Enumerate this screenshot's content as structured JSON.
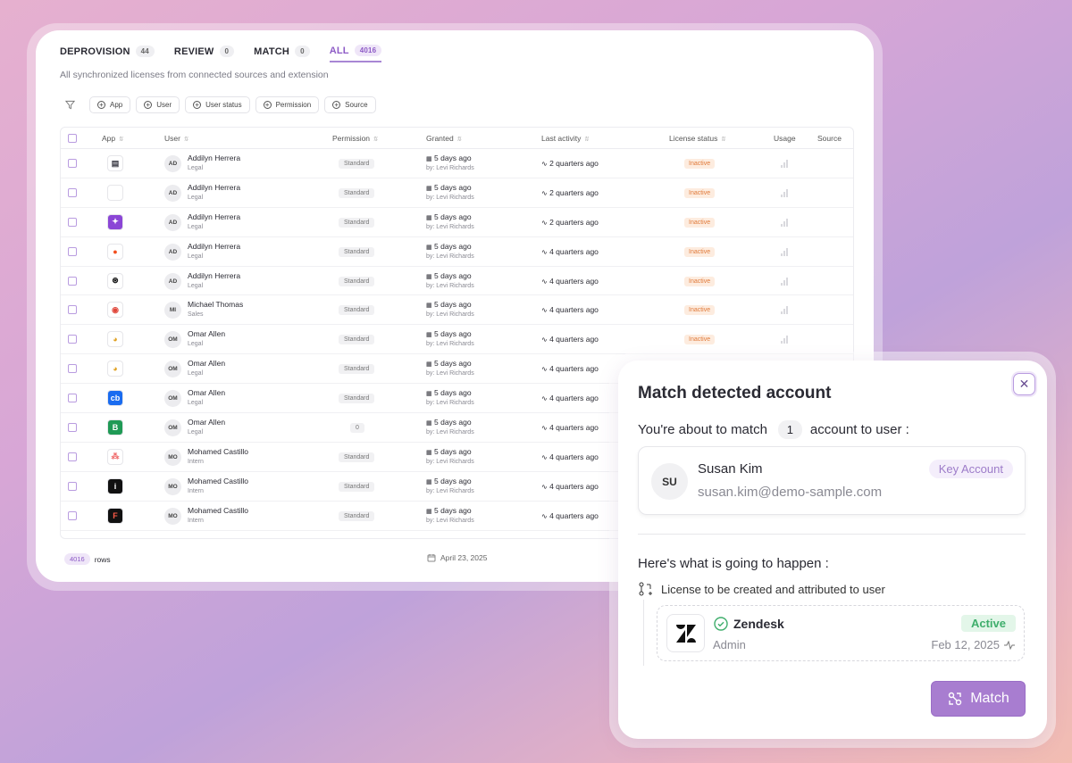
{
  "tabs": [
    {
      "label": "DEPROVISION",
      "count": "44"
    },
    {
      "label": "REVIEW",
      "count": "0"
    },
    {
      "label": "MATCH",
      "count": "0"
    },
    {
      "label": "ALL",
      "count": "4016"
    }
  ],
  "active_tab": "ALL",
  "subtitle": "All synchronized licenses from connected sources and extension",
  "filters": [
    "App",
    "User",
    "User status",
    "Permission",
    "Source"
  ],
  "table": {
    "headers": {
      "app": "App",
      "user": "User",
      "permission": "Permission",
      "granted": "Granted",
      "last_activity": "Last activity",
      "license_status": "License status",
      "usage": "Usage",
      "source": "Source"
    },
    "rows": [
      {
        "app_icon": "doc-icon",
        "initials": "AD",
        "name": "Addilyn Herrera",
        "dept": "Legal",
        "permission": "Standard",
        "granted": "5 days ago",
        "by": "by: Levi Richards",
        "activity": "2 quarters ago",
        "status": "Inactive"
      },
      {
        "app_icon": "apple-icon",
        "initials": "AD",
        "name": "Addilyn Herrera",
        "dept": "Legal",
        "permission": "Standard",
        "granted": "5 days ago",
        "by": "by: Levi Richards",
        "activity": "2 quarters ago",
        "status": "Inactive"
      },
      {
        "app_icon": "purple-app-icon",
        "initials": "AD",
        "name": "Addilyn Herrera",
        "dept": "Legal",
        "permission": "Standard",
        "granted": "5 days ago",
        "by": "by: Levi Richards",
        "activity": "2 quarters ago",
        "status": "Inactive"
      },
      {
        "app_icon": "figma-icon",
        "initials": "AD",
        "name": "Addilyn Herrera",
        "dept": "Legal",
        "permission": "Standard",
        "granted": "5 days ago",
        "by": "by: Levi Richards",
        "activity": "4 quarters ago",
        "status": "Inactive"
      },
      {
        "app_icon": "openai-icon",
        "initials": "AD",
        "name": "Addilyn Herrera",
        "dept": "Legal",
        "permission": "Standard",
        "granted": "5 days ago",
        "by": "by: Levi Richards",
        "activity": "4 quarters ago",
        "status": "Inactive"
      },
      {
        "app_icon": "red-circle-icon",
        "initials": "MI",
        "name": "Michael Thomas",
        "dept": "Sales",
        "permission": "Standard",
        "granted": "5 days ago",
        "by": "by: Levi Richards",
        "activity": "4 quarters ago",
        "status": "Inactive"
      },
      {
        "app_icon": "chrome-icon",
        "initials": "OM",
        "name": "Omar Allen",
        "dept": "Legal",
        "permission": "Standard",
        "granted": "5 days ago",
        "by": "by: Levi Richards",
        "activity": "4 quarters ago",
        "status": "Inactive"
      },
      {
        "app_icon": "chrome-icon",
        "initials": "OM",
        "name": "Omar Allen",
        "dept": "Legal",
        "permission": "Standard",
        "granted": "5 days ago",
        "by": "by: Levi Richards",
        "activity": "4 quarters ago",
        "status": ""
      },
      {
        "app_icon": "coinbase-icon",
        "initials": "OM",
        "name": "Omar Allen",
        "dept": "Legal",
        "permission": "Standard",
        "granted": "5 days ago",
        "by": "by: Levi Richards",
        "activity": "4 quarters ago",
        "status": ""
      },
      {
        "app_icon": "green-b-icon",
        "initials": "OM",
        "name": "Omar Allen",
        "dept": "Legal",
        "permission": "0",
        "granted": "5 days ago",
        "by": "by: Levi Richards",
        "activity": "4 quarters ago",
        "status": ""
      },
      {
        "app_icon": "asana-icon",
        "initials": "MO",
        "name": "Mohamed Castillo",
        "dept": "Intern",
        "permission": "Standard",
        "granted": "5 days ago",
        "by": "by: Levi Richards",
        "activity": "4 quarters ago",
        "status": ""
      },
      {
        "app_icon": "black-i-icon",
        "initials": "MO",
        "name": "Mohamed Castillo",
        "dept": "Intern",
        "permission": "Standard",
        "granted": "5 days ago",
        "by": "by: Levi Richards",
        "activity": "4 quarters ago",
        "status": ""
      },
      {
        "app_icon": "figma-dark-icon",
        "initials": "MO",
        "name": "Mohamed Castillo",
        "dept": "Intern",
        "permission": "Standard",
        "granted": "5 days ago",
        "by": "by: Levi Richards",
        "activity": "4 quarters ago",
        "status": ""
      }
    ]
  },
  "footer": {
    "row_count": "4016",
    "rows_label": "rows",
    "date": "April 23, 2025"
  },
  "modal": {
    "title": "Match detected account",
    "line_prefix": "You're about to match",
    "count": "1",
    "line_suffix": "account to user :",
    "user": {
      "initials": "SU",
      "name": "Susan Kim",
      "email": "susan.kim@demo-sample.com",
      "badge": "Key Account"
    },
    "what_happens": "Here's what is going to happen :",
    "license_line": "License to be created and attributed to user",
    "license": {
      "app": "Zendesk",
      "role": "Admin",
      "status": "Active",
      "date": "Feb 12, 2025"
    },
    "match_button": "Match"
  },
  "colors": {
    "accent": "#a87dd0",
    "inactive": "#e07a3a",
    "active": "#3fae6c"
  }
}
